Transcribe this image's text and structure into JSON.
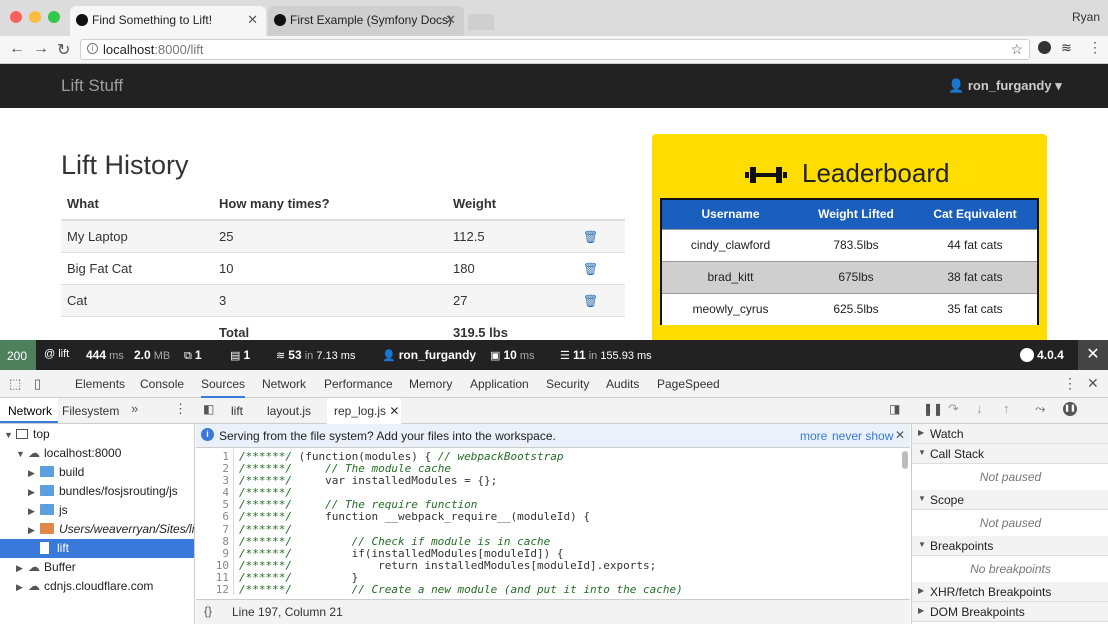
{
  "browser": {
    "tabs": [
      {
        "title": "Find Something to Lift!",
        "active": true
      },
      {
        "title": "First Example (Symfony Docs)",
        "active": false
      }
    ],
    "user": "Ryan",
    "url_host": "localhost",
    "url_rest": ":8000/lift"
  },
  "site": {
    "brand": "Lift Stuff",
    "user": "ron_furgandy"
  },
  "history": {
    "title": "Lift History",
    "headers": [
      "What",
      "How many times?",
      "Weight"
    ],
    "rows": [
      {
        "what": "My Laptop",
        "times": "25",
        "weight": "112.5"
      },
      {
        "what": "Big Fat Cat",
        "times": "10",
        "weight": "180"
      },
      {
        "what": "Cat",
        "times": "3",
        "weight": "27"
      }
    ],
    "total_label": "Total",
    "total_value": "319.5 lbs"
  },
  "leaderboard": {
    "title": "Leaderboard",
    "headers": [
      "Username",
      "Weight Lifted",
      "Cat Equivalent"
    ],
    "rows": [
      {
        "user": "cindy_clawford",
        "weight": "783.5lbs",
        "cats": "44 fat cats"
      },
      {
        "user": "brad_kitt",
        "weight": "675lbs",
        "cats": "38 fat cats"
      },
      {
        "user": "meowly_cyrus",
        "weight": "625.5lbs",
        "cats": "35 fat cats"
      }
    ]
  },
  "toolbar": {
    "status": "200",
    "route": "@ lift",
    "time": "444",
    "time_unit": "ms",
    "memory": "2.0",
    "memory_unit": "MB",
    "forms": "1",
    "logs": "1",
    "twig_count": "53",
    "twig_in": "in",
    "twig_time": "7.13 ms",
    "user": "ron_furgandy",
    "ajax": "10",
    "ajax_unit": "ms",
    "db_count": "11",
    "db_in": "in",
    "db_time": "155.93 ms",
    "version": "4.0.4"
  },
  "devtools": {
    "tabs": [
      "Elements",
      "Console",
      "Sources",
      "Network",
      "Performance",
      "Memory",
      "Application",
      "Security",
      "Audits",
      "PageSpeed"
    ],
    "active_tab": "Sources",
    "nav_tabs": [
      "Network",
      "Filesystem"
    ],
    "file_tabs": [
      "lift",
      "layout.js",
      "rep_log.js"
    ],
    "tree": [
      "top",
      "localhost:8000",
      "build",
      "bundles/fosjsrouting/js",
      "js",
      "Users/weaverryan/Sites/lift",
      "lift",
      "Buffer",
      "cdnjs.cloudflare.com"
    ],
    "info": "Serving from the file system? Add your files into the workspace.",
    "info_more": "more",
    "info_never": "never show",
    "status": "Line 197, Column 21",
    "sections": [
      "Watch",
      "Call Stack",
      "Scope",
      "Breakpoints",
      "XHR/fetch Breakpoints",
      "DOM Breakpoints"
    ],
    "not_paused": "Not paused",
    "no_breakpoints": "No breakpoints",
    "code": [
      {
        "p": "/******/ ",
        "t": "(function(modules) { ",
        "c": "// webpackBootstrap"
      },
      {
        "p": "/******/ ",
        "t": "    ",
        "c": "// The module cache"
      },
      {
        "p": "/******/ ",
        "t": "    var installedModules = {};",
        "c": ""
      },
      {
        "p": "/******/",
        "t": "",
        "c": ""
      },
      {
        "p": "/******/ ",
        "t": "    ",
        "c": "// The require function"
      },
      {
        "p": "/******/ ",
        "t": "    function __webpack_require__(moduleId) {",
        "c": ""
      },
      {
        "p": "/******/",
        "t": "",
        "c": ""
      },
      {
        "p": "/******/ ",
        "t": "        ",
        "c": "// Check if module is in cache"
      },
      {
        "p": "/******/ ",
        "t": "        if(installedModules[moduleId]) {",
        "c": ""
      },
      {
        "p": "/******/ ",
        "t": "            return installedModules[moduleId].exports;",
        "c": ""
      },
      {
        "p": "/******/ ",
        "t": "        }",
        "c": ""
      },
      {
        "p": "/******/ ",
        "t": "        ",
        "c": "// Create a new module (and put it into the cache)"
      }
    ]
  }
}
